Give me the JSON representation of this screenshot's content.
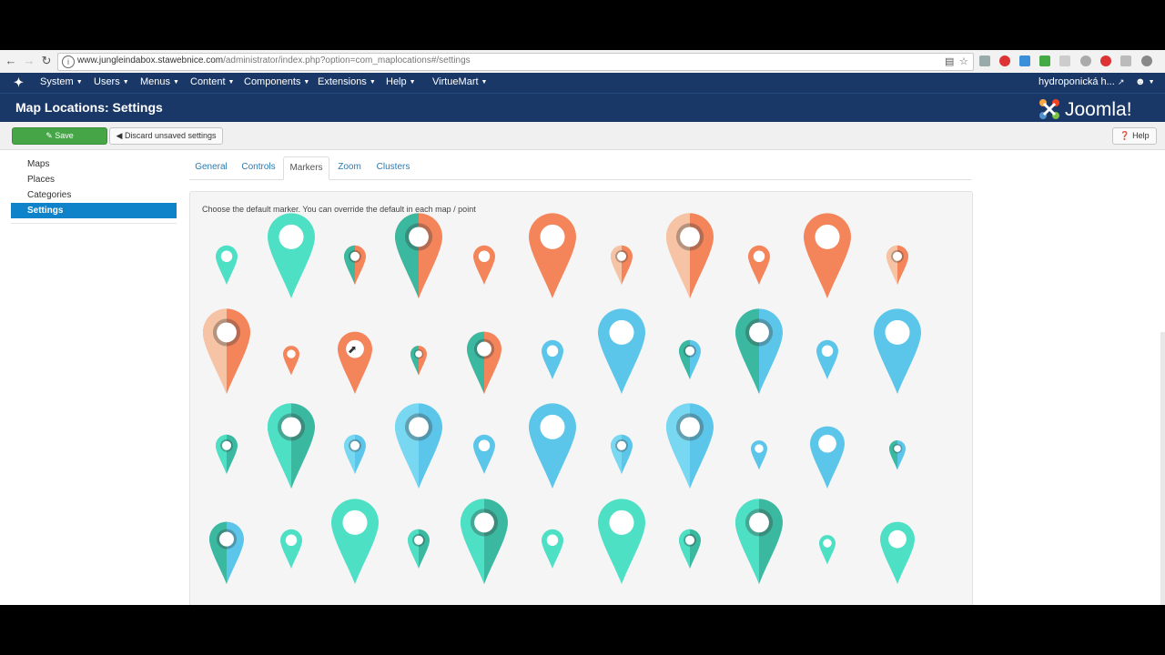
{
  "browser": {
    "url_host": "www.jungleindabox.stawebnice.com",
    "url_path": "/administrator/index.php?option=com_maplocations#/settings"
  },
  "topnav": {
    "items": [
      "System",
      "Users",
      "Menus",
      "Content",
      "Components",
      "Extensions",
      "Help",
      "VirtueMart"
    ],
    "user": "hydroponická h..."
  },
  "page": {
    "title": "Map Locations: Settings",
    "brand": "Joomla!"
  },
  "toolbar": {
    "save_label": "Save",
    "discard_label": "Discard unsaved settings",
    "help_label": "Help"
  },
  "sidebar": {
    "items": [
      {
        "label": "Maps"
      },
      {
        "label": "Places"
      },
      {
        "label": "Categories"
      },
      {
        "label": "Settings",
        "active": true
      }
    ]
  },
  "tabs": {
    "items": [
      "General",
      "Controls",
      "Markers",
      "Zoom",
      "Clusters"
    ],
    "active": "Markers"
  },
  "markers_panel": {
    "instruction": "Choose the default marker. You can override the default in each map / point",
    "colors": {
      "teal": "#4ee0c5",
      "teal_dark": "#3ab9a0",
      "orange": "#f4845a",
      "peach": "#f6c4a4",
      "blue": "#5bc6ea",
      "blue_dark": "#3ea7d3"
    },
    "rows": [
      [
        {
          "size": "s",
          "style": "solid",
          "color": "teal"
        },
        {
          "size": "l",
          "style": "solid",
          "color": "teal"
        },
        {
          "size": "s",
          "style": "split",
          "color": "teal_orange"
        },
        {
          "size": "l",
          "style": "split",
          "color": "teal_orange"
        },
        {
          "size": "s",
          "style": "solid",
          "color": "orange"
        },
        {
          "size": "l",
          "style": "solid",
          "color": "orange"
        },
        {
          "size": "s",
          "style": "split",
          "color": "peach_orange"
        },
        {
          "size": "l",
          "style": "split",
          "color": "peach_orange"
        },
        {
          "size": "s",
          "style": "solid",
          "color": "orange"
        },
        {
          "size": "l",
          "style": "solid",
          "color": "orange"
        },
        {
          "size": "s",
          "style": "split",
          "color": "peach_orange"
        }
      ],
      [
        {
          "size": "l",
          "style": "split",
          "color": "peach_orange"
        },
        {
          "size": "xs",
          "style": "solid",
          "color": "orange"
        },
        {
          "size": "m",
          "style": "solid",
          "color": "orange"
        },
        {
          "size": "xs",
          "style": "split",
          "color": "teal_orange"
        },
        {
          "size": "m",
          "style": "split",
          "color": "teal_orange"
        },
        {
          "size": "s",
          "style": "solid",
          "color": "blue"
        },
        {
          "size": "l",
          "style": "solid",
          "color": "blue"
        },
        {
          "size": "s",
          "style": "split",
          "color": "teal_blue"
        },
        {
          "size": "l",
          "style": "split",
          "color": "teal_blue"
        },
        {
          "size": "s",
          "style": "solid",
          "color": "blue"
        },
        {
          "size": "l",
          "style": "solid",
          "color": "blue"
        }
      ],
      [
        {
          "size": "s",
          "style": "split",
          "color": "teal_dark"
        },
        {
          "size": "l",
          "style": "split",
          "color": "teal_dark"
        },
        {
          "size": "s",
          "style": "split",
          "color": "blue_light"
        },
        {
          "size": "l",
          "style": "split",
          "color": "blue_light"
        },
        {
          "size": "s",
          "style": "solid",
          "color": "blue"
        },
        {
          "size": "l",
          "style": "solid",
          "color": "blue"
        },
        {
          "size": "s",
          "style": "split",
          "color": "blue_light"
        },
        {
          "size": "l",
          "style": "split",
          "color": "blue_light"
        },
        {
          "size": "xs",
          "style": "solid",
          "color": "blue"
        },
        {
          "size": "m",
          "style": "solid",
          "color": "blue"
        },
        {
          "size": "xs",
          "style": "split",
          "color": "teal_blue"
        }
      ],
      [
        {
          "size": "m",
          "style": "split",
          "color": "teal_blue"
        },
        {
          "size": "s",
          "style": "solid",
          "color": "teal"
        },
        {
          "size": "l",
          "style": "solid",
          "color": "teal"
        },
        {
          "size": "s",
          "style": "split",
          "color": "teal_dark"
        },
        {
          "size": "l",
          "style": "split",
          "color": "teal_dark"
        },
        {
          "size": "s",
          "style": "solid",
          "color": "teal"
        },
        {
          "size": "l",
          "style": "solid",
          "color": "teal"
        },
        {
          "size": "s",
          "style": "split",
          "color": "teal_dark"
        },
        {
          "size": "l",
          "style": "split",
          "color": "teal_dark"
        },
        {
          "size": "xs",
          "style": "solid",
          "color": "teal"
        },
        {
          "size": "m",
          "style": "solid",
          "color": "teal"
        }
      ]
    ]
  }
}
